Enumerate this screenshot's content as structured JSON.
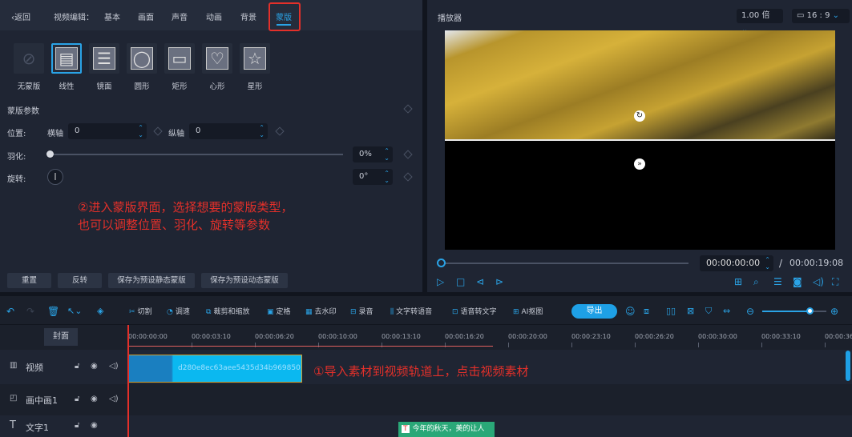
{
  "editor": {
    "back": "返回",
    "title": "视频编辑：",
    "tabs": [
      "基本",
      "画面",
      "声音",
      "动画",
      "背景",
      "蒙版"
    ],
    "active_tab": "蒙版",
    "masks": [
      {
        "label": "无蒙版",
        "icon": "no-mask-icon"
      },
      {
        "label": "线性",
        "icon": "linear-mask-icon"
      },
      {
        "label": "镜面",
        "icon": "mirror-mask-icon"
      },
      {
        "label": "圆形",
        "icon": "circle-mask-icon"
      },
      {
        "label": "矩形",
        "icon": "rectangle-mask-icon"
      },
      {
        "label": "心形",
        "icon": "heart-mask-icon"
      },
      {
        "label": "星形",
        "icon": "star-mask-icon"
      }
    ],
    "selected_mask": "线性",
    "params": {
      "title": "蒙版参数",
      "position_label": "位置:",
      "x_label": "横轴",
      "x_value": "0",
      "y_label": "纵轴",
      "y_value": "0",
      "feather_label": "羽化:",
      "feather_value": "0%",
      "feather_percent": 0,
      "rotate_label": "旋转:",
      "rotate_value": "0°"
    },
    "annotation": [
      "②进入蒙版界面，选择想要的蒙版类型，",
      "也可以调整位置、羽化、旋转等参数"
    ],
    "buttons": [
      "重置",
      "反转",
      "保存为预设静态蒙版",
      "保存为预设动态蒙版"
    ]
  },
  "player": {
    "title": "播放器",
    "speed": "1.00 倍",
    "ratio": "16 : 9",
    "current_time": "00:00:00:00",
    "separator": "/",
    "total_time": "00:00:19:08",
    "progress": 0
  },
  "toolbar": {
    "tools": [
      "切割",
      "调速",
      "裁剪和缩放",
      "定格",
      "去水印",
      "录音",
      "文字转语音",
      "语音转文字",
      "AI抠图"
    ],
    "export": "导出",
    "zoom_level": 0.75
  },
  "timeline": {
    "cover": "封面",
    "ticks": [
      "00:00:00:00",
      "00:00:03:10",
      "00:00:06:20",
      "00:00:10:00",
      "00:00:13:10",
      "00:00:16:20",
      "00:00:20:00",
      "00:00:23:10",
      "00:00:26:20",
      "00:00:30:00",
      "00:00:33:10",
      "00:00:36"
    ],
    "tracks": [
      {
        "name": "视频",
        "icon": "film-icon"
      },
      {
        "name": "画中画1",
        "icon": "pip-icon"
      },
      {
        "name": "文字1",
        "icon": "text-icon"
      }
    ],
    "clip_name": "d280e8ec63aee5435d34b969850",
    "text_clip": "今年的秋天，美的让人",
    "annotation": "①导入素材到视频轨道上，点击视频素材"
  },
  "colors": {
    "accent": "#2aa3e6",
    "annotation": "#e3302a",
    "highlight_box": "#e3302a"
  }
}
